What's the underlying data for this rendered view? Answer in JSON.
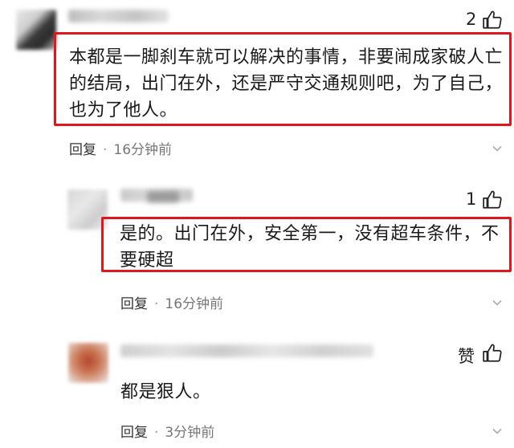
{
  "comments": [
    {
      "like_count": "2",
      "text": "本都是一脚刹车就可以解决的事情，非要闹成家破人亡的结局，出门在外，还是严守交通规则吧，为了自己，也为了他人。",
      "reply_label": "回复",
      "separator": "·",
      "time": "16分钟前"
    },
    {
      "like_count": "1",
      "text": "是的。出门在外，安全第一，没有超车条件，不要硬超",
      "reply_label": "回复",
      "separator": "·",
      "time": "16分钟前"
    },
    {
      "like_label": "赞",
      "text": "都是狠人。",
      "reply_label": "回复",
      "separator": "·",
      "time": "3分钟前"
    }
  ],
  "colors": {
    "highlight_border": "#e0161d",
    "text": "#1a1a1a",
    "muted": "#777777"
  },
  "icons": [
    "thumbs-up-icon",
    "chevron-down-icon"
  ]
}
